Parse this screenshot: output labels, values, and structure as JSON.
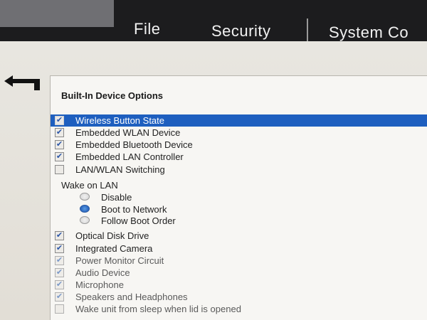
{
  "menu": {
    "file": "File",
    "security": "Security",
    "system": "System Co"
  },
  "panel": {
    "title": "Built-In Device Options",
    "devices_top": [
      {
        "label": "Wireless Button State",
        "checked": true,
        "selected": true
      },
      {
        "label": "Embedded WLAN Device",
        "checked": true
      },
      {
        "label": "Embedded Bluetooth Device",
        "checked": true
      },
      {
        "label": "Embedded LAN Controller",
        "checked": true
      },
      {
        "label": "LAN/WLAN Switching",
        "checked": false
      }
    ],
    "wake_on_lan": {
      "label": "Wake on LAN",
      "options": [
        {
          "label": "Disable",
          "selected": false
        },
        {
          "label": "Boot to Network",
          "selected": true
        },
        {
          "label": "Follow Boot Order",
          "selected": false
        }
      ]
    },
    "devices_bottom": [
      {
        "label": "Optical Disk Drive",
        "checked": true
      },
      {
        "label": "Integrated Camera",
        "checked": true
      },
      {
        "label": "Power Monitor Circuit",
        "checked": true
      },
      {
        "label": "Audio Device",
        "checked": true
      },
      {
        "label": "Microphone",
        "checked": true
      },
      {
        "label": "Speakers and Headphones",
        "checked": true
      },
      {
        "label": "Wake unit from sleep when lid is opened",
        "checked": false
      }
    ]
  },
  "colors": {
    "selection": "#1e5fbf",
    "topbar": "#1c1c1e"
  }
}
